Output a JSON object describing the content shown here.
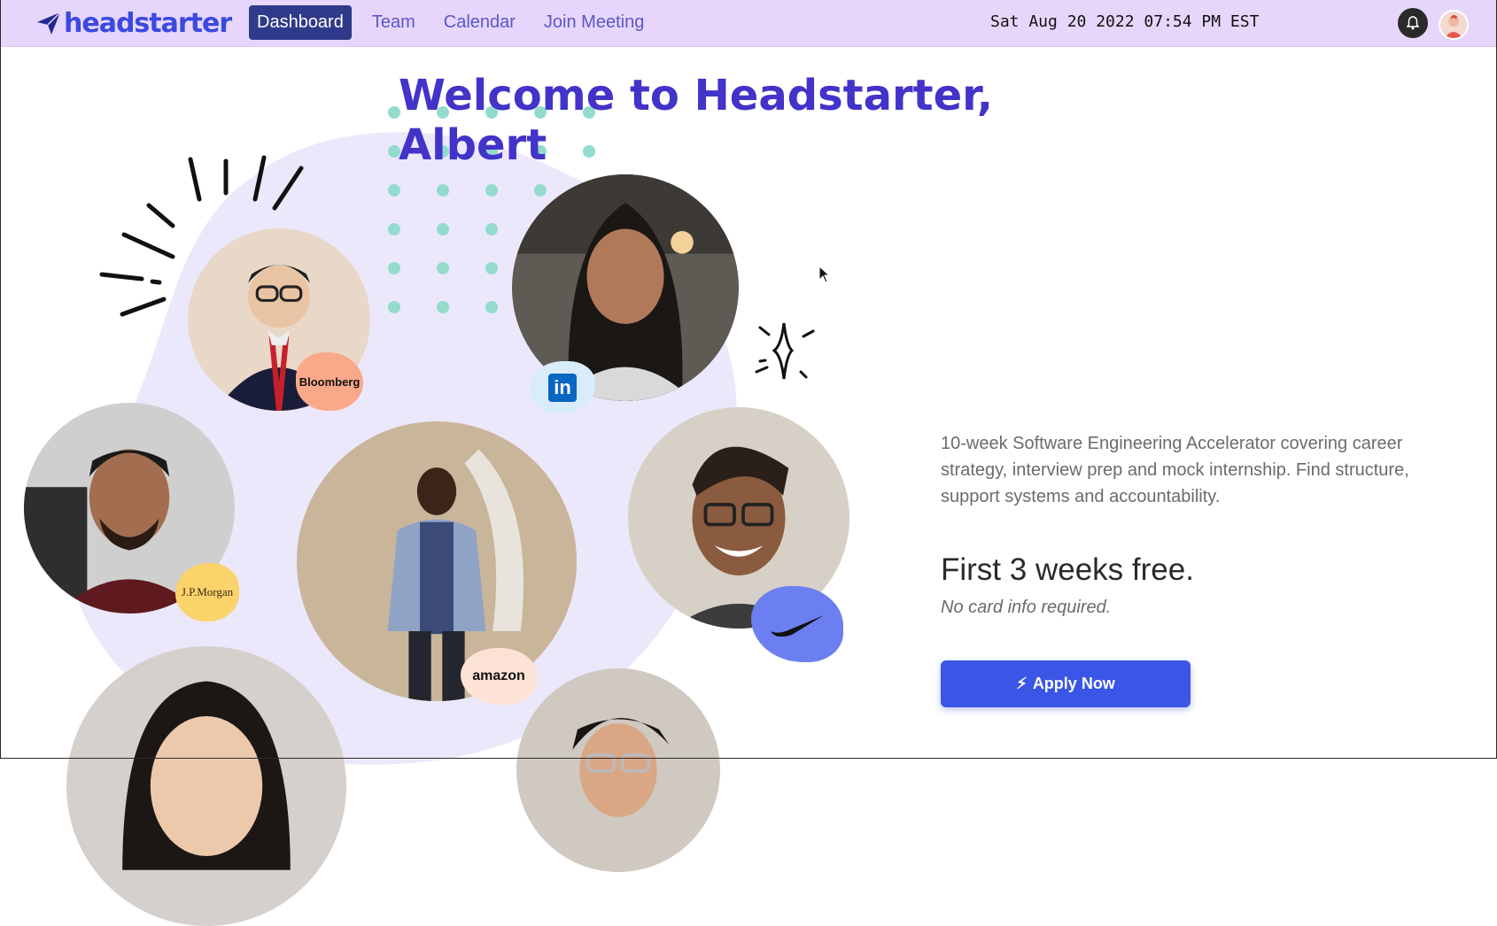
{
  "brand": {
    "name": "headstarter",
    "color": "#3b49df"
  },
  "nav": {
    "items": [
      {
        "label": "Dashboard",
        "active": true
      },
      {
        "label": "Team",
        "active": false
      },
      {
        "label": "Calendar",
        "active": false
      },
      {
        "label": "Join Meeting",
        "active": false
      }
    ]
  },
  "header": {
    "datetime": "Sat Aug 20 2022 07:54 PM EST",
    "notification_icon": "bell-icon",
    "profile_icon": "user-avatar"
  },
  "main": {
    "welcome": "Welcome to Headstarter, Albert",
    "description": "10-week Software Engineering Accelerator covering career strategy, interview prep and mock internship. Find structure, support systems and accountability.",
    "offer_title": "First 3 weeks free.",
    "offer_note": "No card info required.",
    "apply_label": "Apply Now",
    "apply_icon": "lightning-icon"
  },
  "profiles": [
    {
      "company": "Bloomberg",
      "badge_color": "#f9a98a"
    },
    {
      "company": "in",
      "badge_color": "#d8ecfb"
    },
    {
      "company": "J.P.Morgan",
      "badge_color": "#fbd36b"
    },
    {
      "company": "amazon",
      "badge_color": "#fde3d5"
    },
    {
      "company": "nike-swoosh",
      "badge_color": "#6b7ff0"
    }
  ],
  "colors": {
    "nav_bg": "#e7d6fb",
    "accent": "#4233c9",
    "button": "#3b55e6",
    "dots": "#93dccd",
    "blob": "#ece8fb"
  }
}
